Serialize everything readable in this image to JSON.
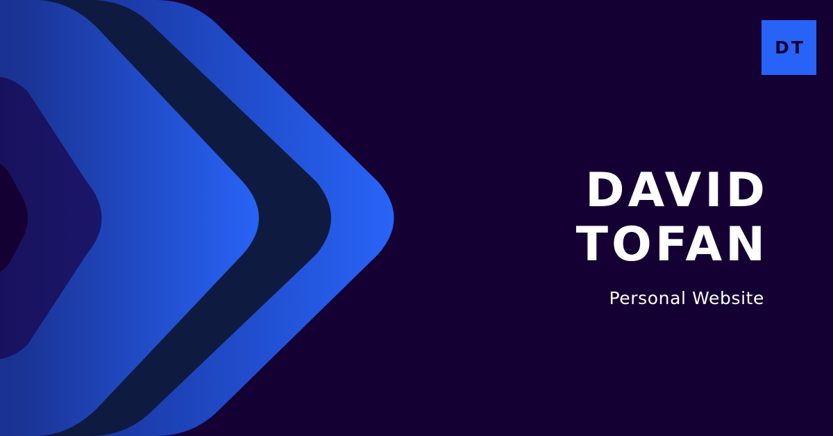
{
  "colors": {
    "background": "#150034",
    "accent": "#2863f7",
    "text": "#ffffff",
    "logo_text": "#150034"
  },
  "logo": {
    "text": "DT"
  },
  "hero": {
    "name_line_1": "DAVID",
    "name_line_2": "TOFAN",
    "subtitle": "Personal Website"
  }
}
